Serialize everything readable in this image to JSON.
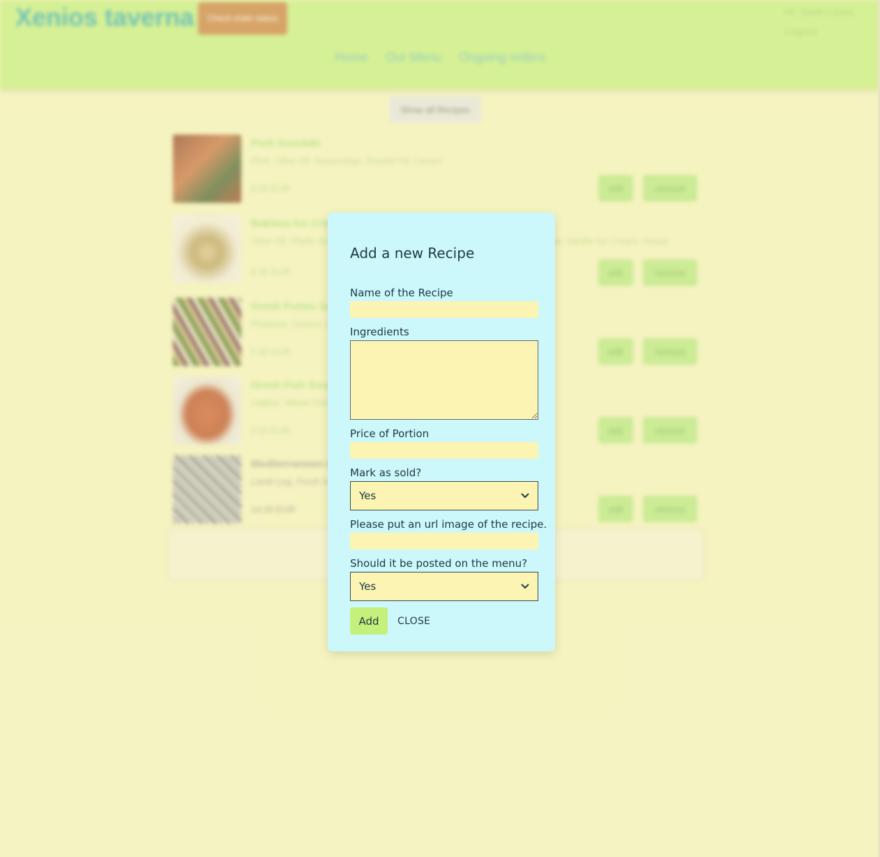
{
  "header": {
    "brand": "Xenios taverna",
    "order_status_button": "Check order status",
    "greeting": "Hi, Nyah Lewis",
    "logout": "Logout",
    "nav": [
      "Home",
      "Our Menu",
      "Ongoing orders"
    ]
  },
  "show_all_button": "Show all Recipes",
  "recipes": [
    {
      "title": "Pork Souvlaki",
      "ingredients": "Pork, Olive Oil, Seasonings, Rosted Oil, Lemon",
      "price": "8.50 EUR",
      "edit": "edit",
      "remove": "remove"
    },
    {
      "title": "Baklava Ice Cream",
      "ingredients": "Olive Oil, Phyllo dough, Walnuts, Pistachios, Cinnamon, Honey, Butter, Sugar, Vanilla Ice Cream, Honey",
      "price": "6.50 EUR",
      "edit": "edit",
      "remove": "remove"
    },
    {
      "title": "Greek Potato Salad",
      "ingredients": "Potatoes, Onions, Olives, Olive Oil, Parsley, Lemon, Seasoning",
      "price": "5.50 EUR",
      "edit": "edit",
      "remove": "remove"
    },
    {
      "title": "Greek Fish Soup",
      "ingredients": "Halibut, Whole Fish, Carrots, Celery, Onions, Potatoes, Lemon, Seasoning",
      "price": "9.50 EUR",
      "edit": "edit",
      "remove": "remove"
    },
    {
      "title": "Mediterranean-style lamb",
      "ingredients": "Lamb Leg, Fresh Herbs, Olive Oil, Garlic, Seasoning",
      "price": "14.00 EUR",
      "edit": "edit",
      "remove": "remove"
    }
  ],
  "modal": {
    "title": "Add a new Recipe",
    "name_label": "Name of the Recipe",
    "name_value": "",
    "ingredients_label": "Ingredients",
    "ingredients_value": "",
    "price_label": "Price of Portion",
    "price_value": "",
    "sold_label": "Mark as sold?",
    "sold_value": "Yes",
    "image_label": "Please put an url image of the recipe.",
    "image_value": "",
    "posted_label": "Should it be posted on the menu?",
    "posted_value": "Yes",
    "add_button": "Add",
    "close_button": "CLOSE"
  },
  "icons": {
    "select_arrow": "chevron-down-icon"
  },
  "colors": {
    "header": "#c5ef7e",
    "page": "#f5f3c1",
    "modal": "#ccf7fb",
    "input": "#fbf4b2",
    "accent": "#c4f07b",
    "brand": "#2aa8b0",
    "order_button": "#c67a3a"
  }
}
